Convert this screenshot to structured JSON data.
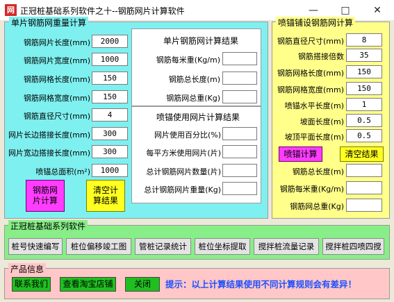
{
  "window": {
    "icon_text": "网",
    "title": "正冠桩基础系列软件之十--钢筋网片计算软件",
    "minimize_icon": "minimize-icon",
    "maximize_icon": "maximize-icon",
    "close_icon": "close-icon"
  },
  "colors": {
    "cyan_panel": "#7ff0f0",
    "yellow_panel": "#ffff8a",
    "green_panel": "#88ee88",
    "white_panel": "#ffffff",
    "magenta_button": "#ff3cff",
    "yellow_button": "#ffff20",
    "green_button": "#1fbf1f",
    "tip_text": "#1e50ff"
  },
  "single_sheet": {
    "title": "单片钢筋网重量计算",
    "fields": [
      {
        "label": "钢筋网片长度(mm)",
        "value": "2000"
      },
      {
        "label": "钢筋网片宽度(mm)",
        "value": "1000"
      },
      {
        "label": "钢筋网格长度(mm)",
        "value": "150"
      },
      {
        "label": "钢筋网格宽度(mm)",
        "value": "150"
      },
      {
        "label": "钢筋直径尺寸(mm)",
        "value": "4"
      },
      {
        "label": "网片长边搭接长度(mm)",
        "value": "300"
      },
      {
        "label": "网片宽边搭接长度(mm)",
        "value": "300"
      },
      {
        "label": "喷锚总面积(m²)",
        "value": "1000"
      }
    ],
    "calc_button": "钢筋网片计算",
    "clear_button": "清空计算结果"
  },
  "single_results": {
    "title": "单片钢筋网计算结果",
    "fields": [
      {
        "label": "钢筋每米重(Kg/m)",
        "value": ""
      },
      {
        "label": "钢筋总长度(m)",
        "value": ""
      },
      {
        "label": "钢筋网总重(Kg)",
        "value": ""
      }
    ]
  },
  "shotcrete_results": {
    "title": "喷锚使用网片计算结果",
    "fields": [
      {
        "label": "网片使用百分比(%)",
        "value": ""
      },
      {
        "label": "每平方米使用网片(片)",
        "value": ""
      },
      {
        "label": "总计钢筋网片数量(片)",
        "value": ""
      },
      {
        "label": "总计钢筋网片重量(Kg)",
        "value": ""
      }
    ]
  },
  "shotcrete_mesh": {
    "title": "喷锚铺设钢筋网计算",
    "fields": [
      {
        "label": "钢筋直径尺寸(mm)",
        "value": "8"
      },
      {
        "label": "钢筋搭接倍数",
        "value": "35"
      },
      {
        "label": "钢筋网格长度(mm)",
        "value": "150"
      },
      {
        "label": "钢筋网格宽度(mm)",
        "value": "150"
      },
      {
        "label": "喷锚水平长度(m)",
        "value": "1"
      },
      {
        "label": "坡面长度(m)",
        "value": "0.5"
      },
      {
        "label": "坡顶平面长度(m)",
        "value": "0.5"
      }
    ],
    "calc_button": "喷锚计算",
    "clear_button": "清空结果",
    "result_fields": [
      {
        "label": "钢筋总长度(m)",
        "value": ""
      },
      {
        "label": "钢筋每米重(Kg/m)",
        "value": ""
      },
      {
        "label": "钢筋网总重(Kg)",
        "value": ""
      }
    ]
  },
  "series": {
    "title": "正冠桩基础系列软件",
    "buttons": [
      "桩号快速编写",
      "桩位偏移竣工图",
      "管桩记录统计",
      "桩位坐标提取",
      "搅拌桩流量记录",
      "搅拌桩四喷四搅"
    ]
  },
  "product": {
    "title": "产品信息",
    "buttons": [
      "联系我们",
      "查看淘宝店铺",
      "关闭"
    ],
    "tip": "提示：以上计算结果使用不同计算规则会有差异！"
  }
}
